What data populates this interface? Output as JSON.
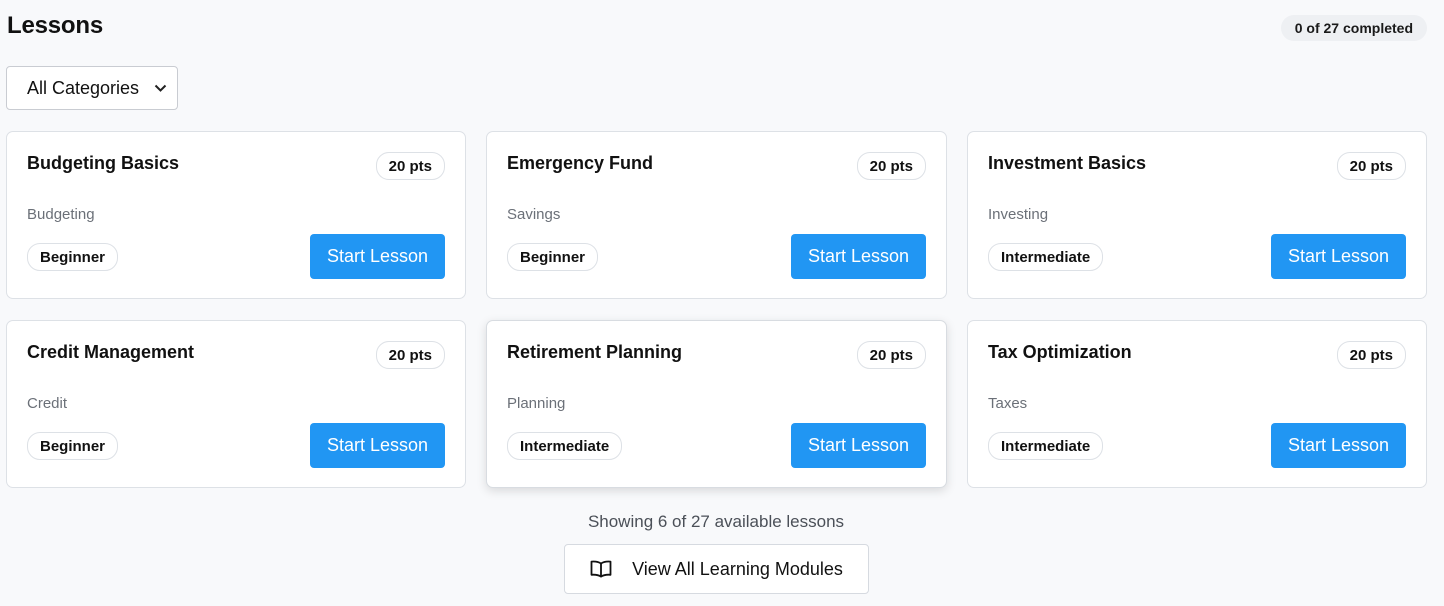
{
  "header": {
    "title": "Lessons",
    "progress": "0 of 27 completed"
  },
  "filter": {
    "selected": "All Categories"
  },
  "lessons": [
    {
      "title": "Budgeting Basics",
      "points": "20 pts",
      "category": "Budgeting",
      "level": "Beginner",
      "action": "Start Lesson"
    },
    {
      "title": "Emergency Fund",
      "points": "20 pts",
      "category": "Savings",
      "level": "Beginner",
      "action": "Start Lesson"
    },
    {
      "title": "Investment Basics",
      "points": "20 pts",
      "category": "Investing",
      "level": "Intermediate",
      "action": "Start Lesson"
    },
    {
      "title": "Credit Management",
      "points": "20 pts",
      "category": "Credit",
      "level": "Beginner",
      "action": "Start Lesson"
    },
    {
      "title": "Retirement Planning",
      "points": "20 pts",
      "category": "Planning",
      "level": "Intermediate",
      "action": "Start Lesson"
    },
    {
      "title": "Tax Optimization",
      "points": "20 pts",
      "category": "Taxes",
      "level": "Intermediate",
      "action": "Start Lesson"
    }
  ],
  "footer": {
    "showing": "Showing 6 of 27 available lessons",
    "view_all_label": "View All Learning Modules",
    "view_all_icon": "book-open-icon"
  },
  "colors": {
    "accent": "#2196f3",
    "background": "#f8f9fb",
    "muted_text": "#6b7078"
  }
}
